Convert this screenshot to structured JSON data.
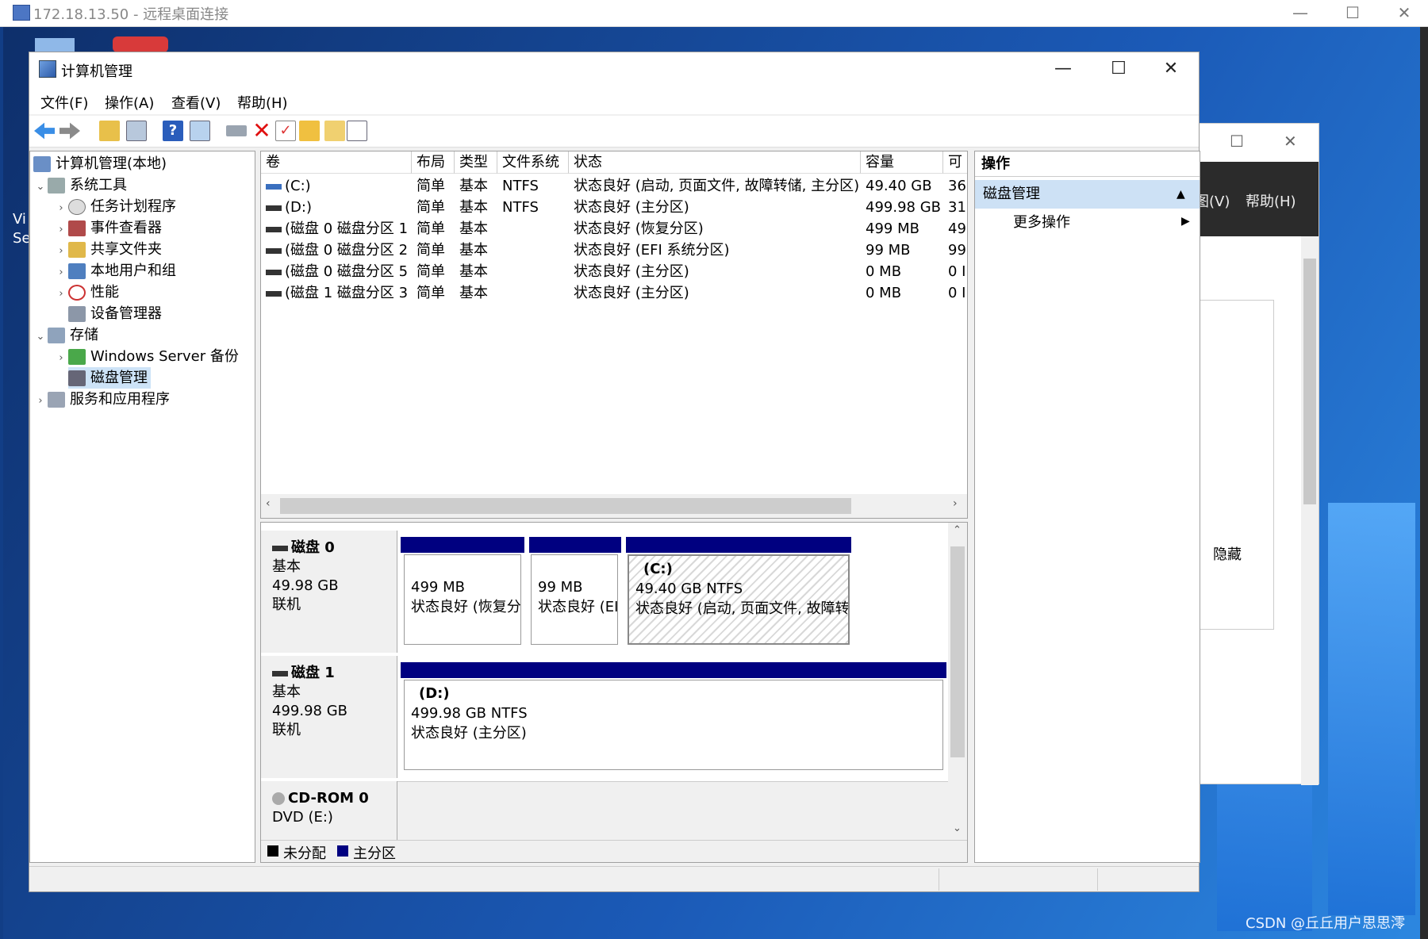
{
  "rdp": {
    "title": "172.18.13.50 - 远程桌面连接",
    "minimize": "—",
    "maximize": "☐",
    "close": "✕"
  },
  "bg_window": {
    "menu_view": "图(V)",
    "menu_help": "帮助(H)",
    "button": "隐藏",
    "minimize": "☐",
    "close": "✕"
  },
  "desktop": {
    "left_text1": "Vi",
    "left_text2": "Se"
  },
  "window": {
    "title": "计算机管理",
    "minimize": "—",
    "maximize": "☐",
    "close": "✕"
  },
  "menu": [
    "文件(F)",
    "操作(A)",
    "查看(V)",
    "帮助(H)"
  ],
  "tree": {
    "root": "计算机管理(本地)",
    "system_tools": "系统工具",
    "task_scheduler": "任务计划程序",
    "event_viewer": "事件查看器",
    "shared_folders": "共享文件夹",
    "local_users": "本地用户和组",
    "performance": "性能",
    "device_manager": "设备管理器",
    "storage": "存储",
    "wsb": "Windows Server 备份",
    "disk_mgmt": "磁盘管理",
    "services_apps": "服务和应用程序"
  },
  "columns": [
    "卷",
    "布局",
    "类型",
    "文件系统",
    "状态",
    "容量",
    "可"
  ],
  "volumes": [
    {
      "vol": "(C:)",
      "layout": "简单",
      "type": "基本",
      "fs": "NTFS",
      "status": "状态良好 (启动, 页面文件, 故障转储, 主分区)",
      "cap": "49.40 GB",
      "free": "36"
    },
    {
      "vol": "(D:)",
      "layout": "简单",
      "type": "基本",
      "fs": "NTFS",
      "status": "状态良好 (主分区)",
      "cap": "499.98 GB",
      "free": "31"
    },
    {
      "vol": "(磁盘 0 磁盘分区 1)",
      "layout": "简单",
      "type": "基本",
      "fs": "",
      "status": "状态良好 (恢复分区)",
      "cap": "499 MB",
      "free": "49"
    },
    {
      "vol": "(磁盘 0 磁盘分区 2)",
      "layout": "简单",
      "type": "基本",
      "fs": "",
      "status": "状态良好 (EFI 系统分区)",
      "cap": "99 MB",
      "free": "99"
    },
    {
      "vol": "(磁盘 0 磁盘分区 5)",
      "layout": "简单",
      "type": "基本",
      "fs": "",
      "status": "状态良好 (主分区)",
      "cap": "0 MB",
      "free": "0 I"
    },
    {
      "vol": "(磁盘 1 磁盘分区 3)",
      "layout": "简单",
      "type": "基本",
      "fs": "",
      "status": "状态良好 (主分区)",
      "cap": "0 MB",
      "free": "0 I"
    }
  ],
  "disks": {
    "d0": {
      "name": "磁盘 0",
      "type": "基本",
      "size": "49.98 GB",
      "state": "联机",
      "p1": {
        "size": "499 MB",
        "status": "状态良好 (恢复分"
      },
      "p2": {
        "size": "99 MB",
        "status": "状态良好 (EI"
      },
      "p3": {
        "label": "(C:)",
        "size": "49.40 GB NTFS",
        "status": "状态良好 (启动, 页面文件, 故障转"
      }
    },
    "d1": {
      "name": "磁盘 1",
      "type": "基本",
      "size": "499.98 GB",
      "state": "联机",
      "p1": {
        "label": "(D:)",
        "size": "499.98 GB NTFS",
        "status": "状态良好 (主分区)"
      }
    },
    "cd": {
      "name": "CD-ROM 0",
      "type": "DVD (E:)"
    }
  },
  "legend": {
    "unalloc": "未分配",
    "primary": "主分区"
  },
  "actions": {
    "header": "操作",
    "group": "磁盘管理",
    "more": "更多操作"
  },
  "watermark": "CSDN @丘丘用户思思澪",
  "colors": {
    "primary_partition": "#000080",
    "selection": "#cde3f7",
    "action_group": "#cde1f5"
  }
}
